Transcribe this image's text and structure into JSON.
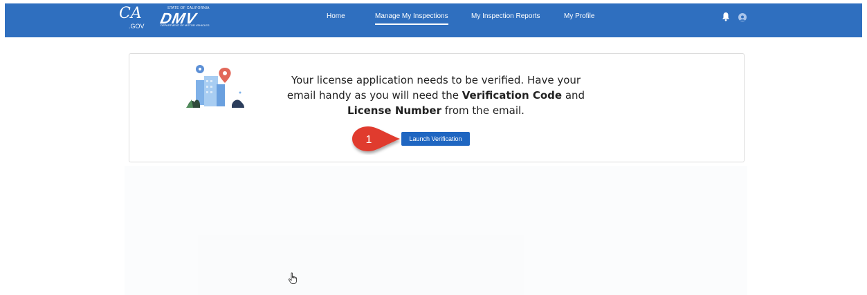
{
  "header": {
    "ca_logo": {
      "main": "CA",
      "sub": ".GOV"
    },
    "dmv_logo": {
      "state": "STATE OF CALIFORNIA",
      "name": "DMV",
      "dept": "DEPARTMENT OF MOTOR VEHICLES"
    },
    "nav": [
      {
        "label": "Home",
        "active": false
      },
      {
        "label": "Manage My Inspections",
        "active": true
      },
      {
        "label": "My Inspection Reports",
        "active": false
      },
      {
        "label": "My Profile",
        "active": false
      }
    ],
    "icons": [
      "bell-icon",
      "user-avatar-icon"
    ],
    "bar_color": "#2f6fbf"
  },
  "card": {
    "message_part1": "Your license application needs to be verified.  Have your email handy as you will need the ",
    "bold1": "Verification Code",
    "message_part2": " and ",
    "bold2": "License Number",
    "message_part3": " from the email.",
    "button_label": "Launch Verification",
    "button_color": "#1f66c1"
  },
  "callout": {
    "number": "1",
    "color": "#e03a2e"
  }
}
